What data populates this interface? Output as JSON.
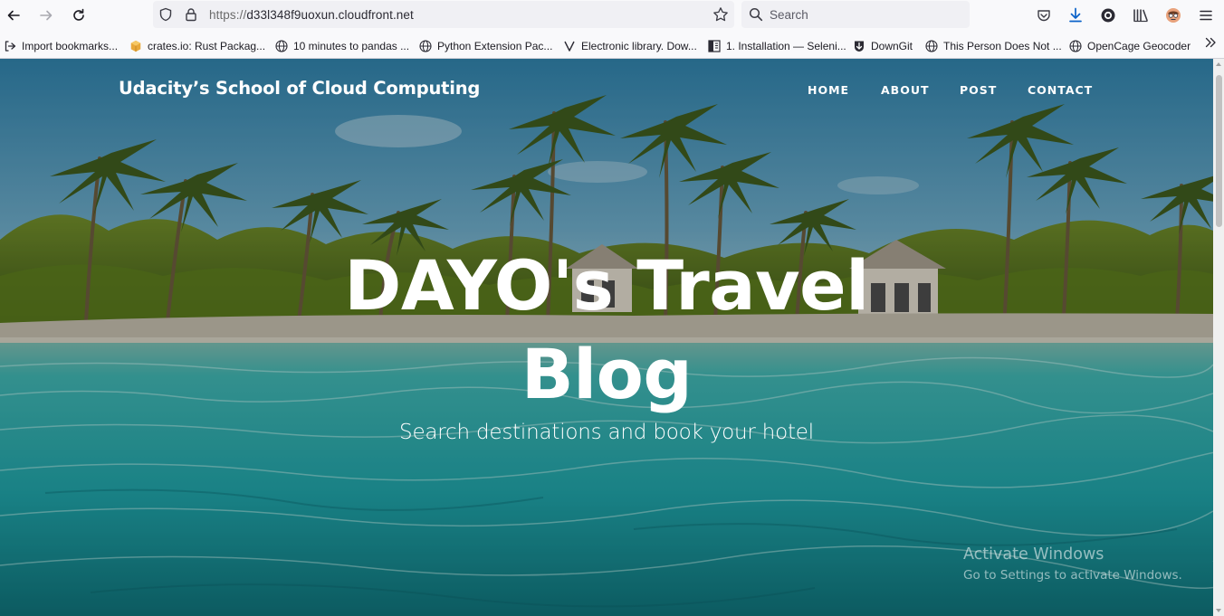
{
  "browser": {
    "url_scheme": "https://",
    "url_host": "d33l348f9uoxun.cloudfront.net",
    "search_placeholder": "Search",
    "icons": [
      "back-icon",
      "forward-icon",
      "reload-icon",
      "shield-icon",
      "lock-icon",
      "bookmark-star-icon",
      "search-icon",
      "pocket-icon",
      "download-icon",
      "extension-icon",
      "library-icon",
      "profile-icon",
      "menu-icon"
    ]
  },
  "bookmarks": {
    "items": [
      {
        "label": "Import bookmarks...",
        "icon": "import-icon"
      },
      {
        "label": "crates.io: Rust Packag...",
        "icon": "crates-icon"
      },
      {
        "label": "10 minutes to pandas ...",
        "icon": "globe-icon"
      },
      {
        "label": "Python Extension Pac...",
        "icon": "globe-icon"
      },
      {
        "label": "Electronic library. Dow...",
        "icon": "zlib-icon"
      },
      {
        "label": "1. Installation — Seleni...",
        "icon": "docs-icon"
      },
      {
        "label": "DownGit",
        "icon": "downgit-icon"
      },
      {
        "label": "This Person Does Not ...",
        "icon": "globe-icon"
      },
      {
        "label": "OpenCage Geocoder",
        "icon": "globe-icon"
      }
    ]
  },
  "site": {
    "brand": "Udacity’s School of Cloud Computing",
    "nav": [
      "HOME",
      "ABOUT",
      "POST",
      "CONTACT"
    ],
    "heading_line1": "DAYO's Travel",
    "heading_line2": "Blog",
    "subheading": "Search destinations and book your hotel"
  },
  "os_watermark": {
    "line1": "Activate Windows",
    "line2": "Go to Settings to activate Windows."
  },
  "colors": {
    "sky": "#3b7fa8",
    "sea": "#2aa6a8",
    "foliage": "#4e6b1f",
    "sand": "#b9b6a8"
  }
}
